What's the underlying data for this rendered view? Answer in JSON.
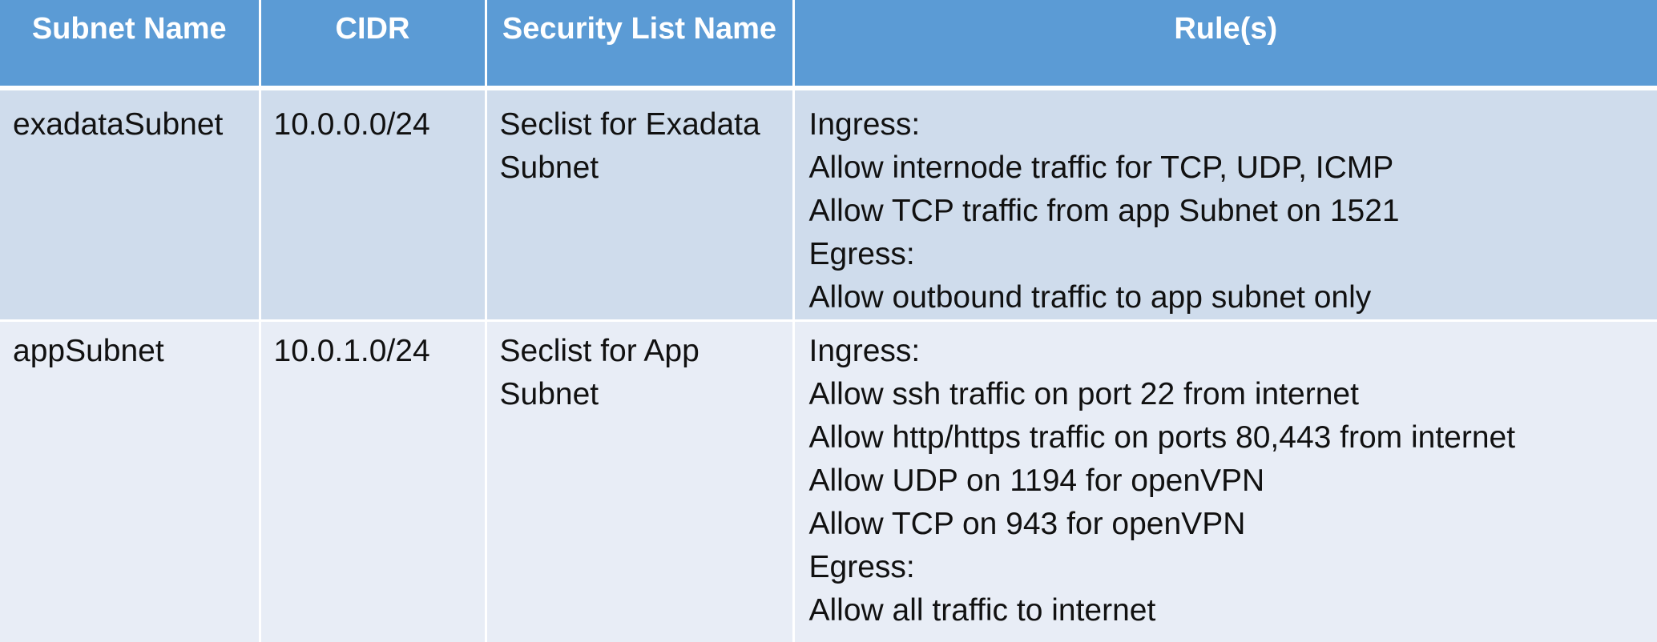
{
  "table": {
    "headers": [
      "Subnet Name",
      "CIDR",
      "Security List Name",
      "Rule(s)"
    ],
    "rows": [
      {
        "subnet_name": "exadataSubnet",
        "cidr": "10.0.0.0/24",
        "security_list_name": "Seclist for Exadata Subnet",
        "rules": [
          "Ingress:",
          "Allow internode traffic for TCP, UDP, ICMP",
          "Allow TCP traffic from app Subnet on 1521",
          "Egress:",
          "Allow outbound traffic to app subnet only"
        ]
      },
      {
        "subnet_name": "appSubnet",
        "cidr": "10.0.1.0/24",
        "security_list_name": "Seclist for App Subnet",
        "rules": [
          "Ingress:",
          "Allow ssh traffic on port 22 from internet",
          "Allow http/https traffic on ports 80,443 from internet",
          "Allow UDP on 1194 for openVPN",
          "Allow TCP on 943 for openVPN",
          "Egress:",
          "Allow all traffic to internet"
        ]
      }
    ]
  },
  "colors": {
    "header_bg": "#5b9bd5",
    "row_dark_bg": "#cfdcec",
    "row_light_bg": "#e8edf6"
  }
}
